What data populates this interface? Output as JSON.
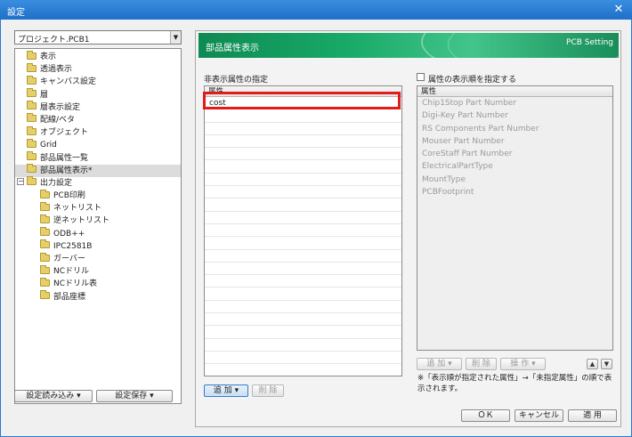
{
  "window": {
    "title": "設定",
    "close_glyph": "✕"
  },
  "project_select": {
    "value": "プロジェクト.PCB1"
  },
  "tree": {
    "items": [
      {
        "label": "表示",
        "level": 1
      },
      {
        "label": "透過表示",
        "level": 1
      },
      {
        "label": "キャンバス設定",
        "level": 1
      },
      {
        "label": "層",
        "level": 1
      },
      {
        "label": "層表示設定",
        "level": 1
      },
      {
        "label": "配線/ベタ",
        "level": 1
      },
      {
        "label": "オブジェクト",
        "level": 1
      },
      {
        "label": "Grid",
        "level": 1
      },
      {
        "label": "部品属性一覧",
        "level": 1
      },
      {
        "label": "部品属性表示*",
        "level": 1,
        "selected": true
      },
      {
        "label": "出力設定",
        "level": 0,
        "expander": "−"
      },
      {
        "label": "PCB印刷",
        "level": 2
      },
      {
        "label": "ネットリスト",
        "level": 2
      },
      {
        "label": "逆ネットリスト",
        "level": 2
      },
      {
        "label": "ODB++",
        "level": 2
      },
      {
        "label": "IPC2581B",
        "level": 2
      },
      {
        "label": "ガーバー",
        "level": 2
      },
      {
        "label": "NCドリル",
        "level": 2
      },
      {
        "label": "NCドリル表",
        "level": 2
      },
      {
        "label": "部品座標",
        "level": 2
      }
    ]
  },
  "bottom_left": {
    "load_label": "設定読み込み ▾",
    "save_label": "設定保存 ▾"
  },
  "banner": {
    "title": "部品属性表示",
    "right_text": "PCB Setting"
  },
  "hidden_attrs": {
    "label": "非表示属性の指定",
    "column": "属性",
    "rows": [
      "cost"
    ],
    "add_label": "追 加 ▾",
    "delete_label": "削 除"
  },
  "display_order": {
    "checkbox_label": "属性の表示順を指定する",
    "column": "属性",
    "rows": [
      "Chip1Stop Part Number",
      "Digi-Key Part Number",
      "RS Components Part Number",
      "Mouser Part Number",
      "CoreStaff Part Number",
      "ElectricalPartType",
      "MountType",
      "PCBFootprint"
    ],
    "add_label": "追 加 ▾",
    "delete_label": "削 除",
    "op_label": "操 作 ▾",
    "up_glyph": "▲",
    "down_glyph": "▼",
    "note": "※「表示順が指定された属性」→「未指定属性」の順で表示されます。"
  },
  "footer": {
    "ok_label": "ＯＫ",
    "cancel_label": "キャンセル",
    "apply_label": "適 用"
  },
  "colors": {
    "titlebar": "#1e6fc8",
    "banner": "#18a968",
    "highlight": "#e21b1b"
  }
}
